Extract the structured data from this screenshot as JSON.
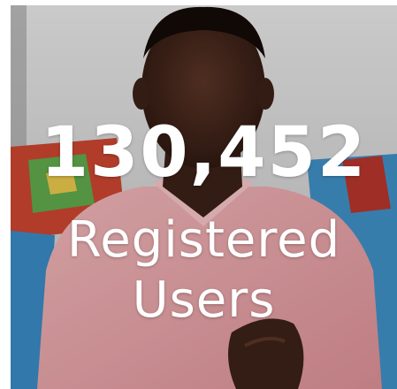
{
  "stat": {
    "value": "130,452",
    "label_line1": "Registered",
    "label_line2": "Users"
  },
  "colors": {
    "text": "#ffffff",
    "shirt": "#e8a8ac",
    "wall": "#d4d4d4",
    "couch_blue": "#3f8fc4"
  }
}
